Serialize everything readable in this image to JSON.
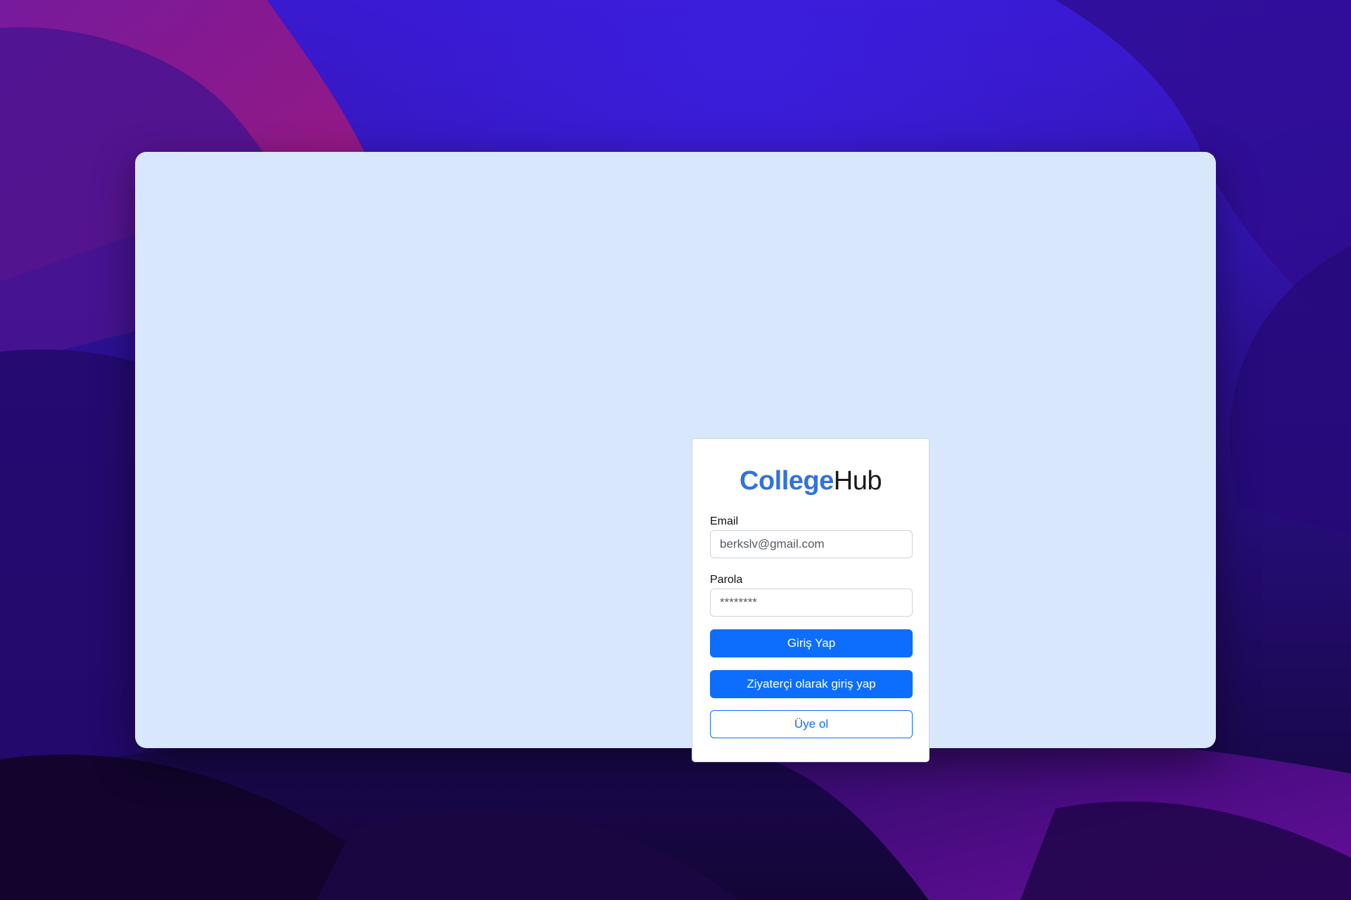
{
  "colors": {
    "window_bg": "#d9e7fc",
    "brand_accent": "#2f74d8",
    "primary": "#0d6efd",
    "card_bg": "#ffffff"
  },
  "brand": {
    "bold": "College",
    "light": "Hub"
  },
  "form": {
    "email_label": "Email",
    "email_value": "berkslv@gmail.com",
    "password_label": "Parola",
    "password_value": "********"
  },
  "buttons": {
    "login": "Giriş Yap",
    "guest_login": "Ziyaterçi olarak giriş yap",
    "signup": "Üye ol"
  }
}
